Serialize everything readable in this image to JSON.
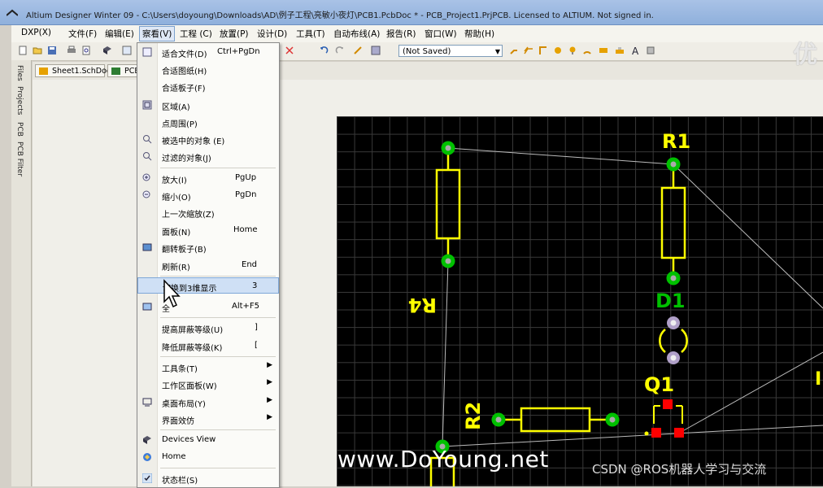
{
  "window": {
    "title": "Altium Designer Winter 09 - C:\\Users\\doyoung\\Downloads\\AD\\例子工程\\亮敏小夜灯\\PCB1.PcbDoc * - PCB_Project1.PrjPCB. Licensed to ALTIUM. Not signed in."
  },
  "menubar": {
    "items": [
      "DXP(X)",
      "文件(F)",
      "编辑(E)",
      "察看(V)",
      "工程 (C)",
      "放置(P)",
      "设计(D)",
      "工具(T)",
      "自动布线(A)",
      "报告(R)",
      "窗口(W)",
      "帮助(H)"
    ]
  },
  "toolbar": {
    "view_config": "(Not Saved)"
  },
  "tabs": [
    "Sheet1.SchDoc",
    "PCB"
  ],
  "side_panels": [
    "Files",
    "Projects",
    "PCB",
    "PCB Filter"
  ],
  "view_menu": {
    "items": [
      {
        "label": "适合文件(D)",
        "shortcut": "Ctrl+PgDn",
        "icon": "fit-document-icon"
      },
      {
        "label": "合适图纸(H)",
        "shortcut": ""
      },
      {
        "label": "合适板子(F)",
        "shortcut": ""
      },
      {
        "label": "区域(A)",
        "shortcut": "",
        "icon": "zoom-area-icon"
      },
      {
        "label": "点周围(P)",
        "shortcut": ""
      },
      {
        "label": "被选中的对象 (E)",
        "shortcut": "",
        "icon": "selected-objects-icon"
      },
      {
        "label": "过滤的对象(J)",
        "shortcut": "",
        "icon": "filtered-objects-icon"
      },
      {
        "label": "放大(I)",
        "shortcut": "PgUp",
        "icon": "zoom-in-icon"
      },
      {
        "label": "缩小(O)",
        "shortcut": "PgDn",
        "icon": "zoom-out-icon"
      },
      {
        "label": "上一次缩放(Z)",
        "shortcut": ""
      },
      {
        "label": "面板(N)",
        "shortcut": "Home"
      },
      {
        "label": "翻转板子(B)",
        "shortcut": "",
        "icon": "flip-board-icon"
      },
      {
        "label": "刷新(R)",
        "shortcut": "End"
      },
      {
        "label": "切换到3维显示",
        "shortcut": "3"
      },
      {
        "label": "全",
        "shortcut": "Alt+F5",
        "icon": "fullscreen-icon"
      },
      {
        "label": "提高屏蔽等级(U)",
        "shortcut": "]"
      },
      {
        "label": "降低屏蔽等级(K)",
        "shortcut": "["
      },
      {
        "label": "工具条(T)",
        "shortcut": "",
        "submenu": true
      },
      {
        "label": "工作区面板(W)",
        "shortcut": "",
        "submenu": true
      },
      {
        "label": "桌面布局(Y)",
        "shortcut": "",
        "submenu": true,
        "icon": "desktop-layout-icon"
      },
      {
        "label": "界面效仿",
        "shortcut": "",
        "submenu": true
      },
      {
        "label": "Devices View",
        "shortcut": "",
        "icon": "devices-view-icon"
      },
      {
        "label": "Home",
        "shortcut": "",
        "icon": "home-icon"
      },
      {
        "label": "状态栏(S)",
        "shortcut": "",
        "icon": "check-icon"
      }
    ]
  },
  "pcb": {
    "designators": [
      "R1",
      "R4",
      "D1",
      "Q1",
      "R2"
    ]
  },
  "watermarks": {
    "logo": "优",
    "site": "www.DoYoung.net",
    "csdn": "CSDN @ROS机器人学习与交流"
  },
  "colors": {
    "menu_highlight": "#cfe0f5",
    "pcb_background": "#000000",
    "silkscreen": "#ffff00",
    "pad": "#00c000",
    "smd_pad": "#ff0000"
  }
}
